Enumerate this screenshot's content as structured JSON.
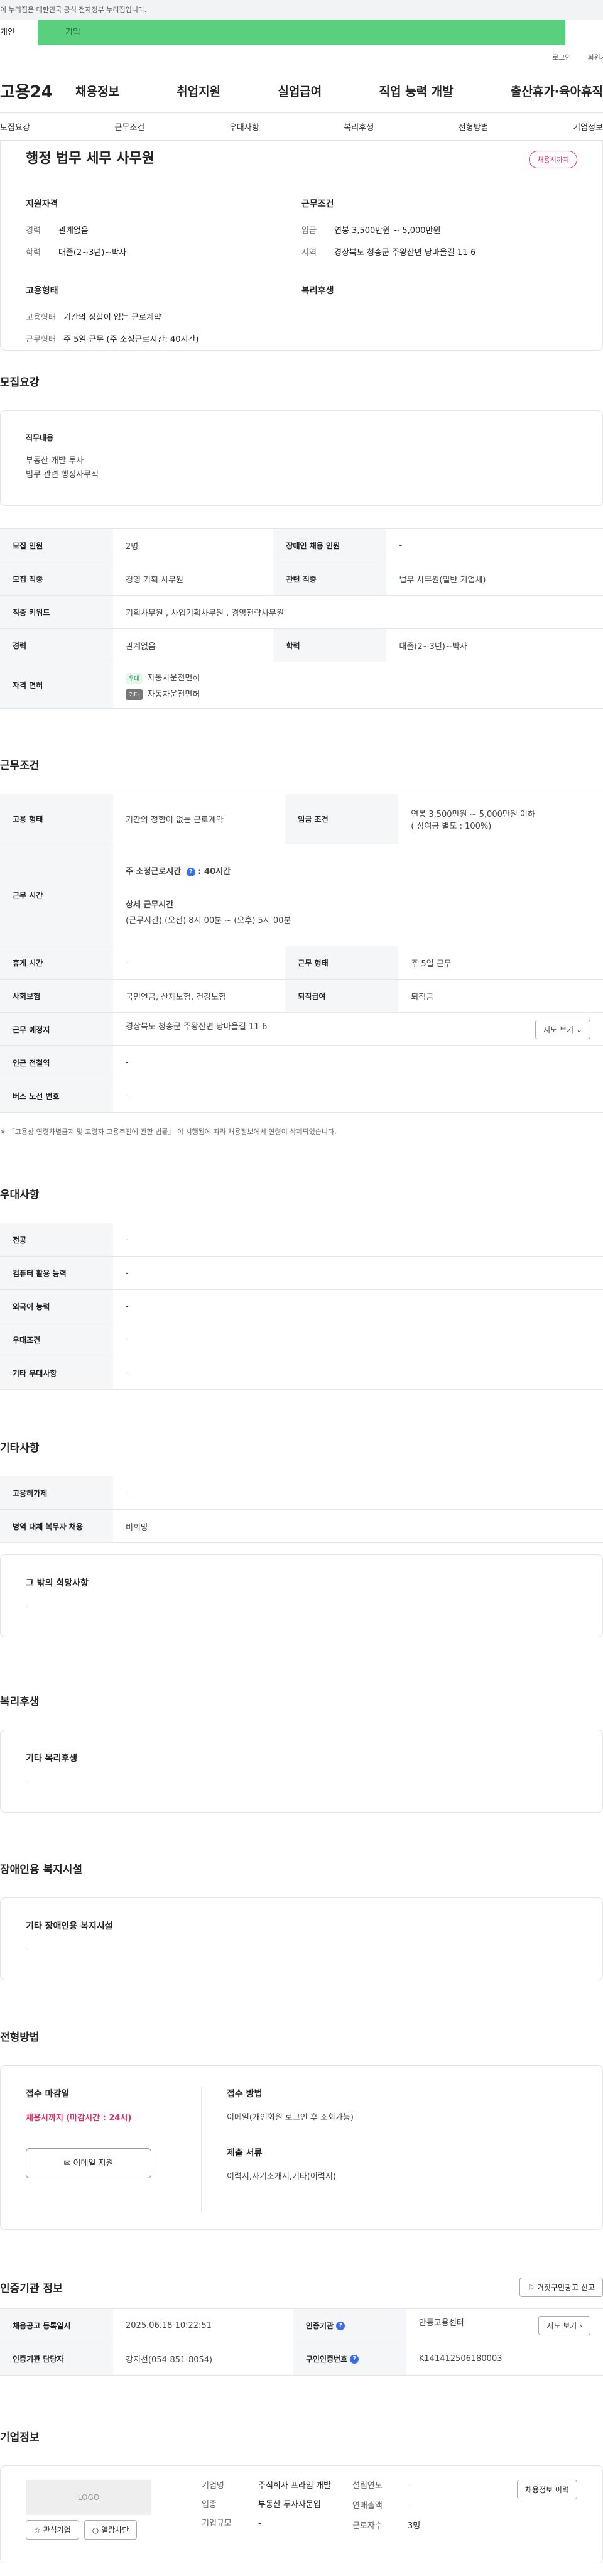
{
  "gov_banner": "이 누리집은 대한민국 공식 전자정부 누리집입니다.",
  "user_tabs": [
    "개인",
    "기업"
  ],
  "util": [
    "로그인",
    "회원가입"
  ],
  "logo": "고용24",
  "gnb": [
    "채용정보",
    "취업지원",
    "실업급여",
    "직업 능력 개발",
    "출산휴가·육아휴직"
  ],
  "subnav": [
    "모집요강",
    "근무조건",
    "우대사항",
    "복리후생",
    "전형방법",
    "기업정보"
  ],
  "top": {
    "title": "행정 법무 세무 사무원",
    "badge": "채용시까지",
    "qual_h": "지원자격",
    "qual": [
      [
        "경력",
        "관계없음"
      ],
      [
        "학력",
        "대졸(2~3년)~박사"
      ]
    ],
    "cond_h": "근무조건",
    "cond": [
      [
        "임금",
        "연봉 3,500만원 ~ 5,000만원"
      ],
      [
        "지역",
        "경상북도 청송군 주왕산면 당마을길 11-6"
      ]
    ],
    "emp_h": "고용형태",
    "emp": [
      [
        "고용형태",
        "기간의 정함이 없는 근로계약"
      ],
      [
        "근무형태",
        "주 5일 근무 (주 소정근로시간: 40시간)"
      ]
    ],
    "welfare_h": "복리후생"
  },
  "recruit": {
    "title": "모집요강",
    "duty_h": "직무내용",
    "duty": [
      "부동산 개발 투자",
      "법무 관련 행정사무직"
    ],
    "rows": [
      [
        "모집 인원",
        "2명",
        "장애인 채용 인원",
        "-"
      ],
      [
        "모집 직종",
        "경영 기획 사무원",
        "관련 직종",
        "법무 사무원(일반 기업체)"
      ],
      [
        "직종 키워드",
        "기획사무원 , 사업기획사무원 , 경영전략사무원"
      ],
      [
        "경력",
        "관계없음",
        "학력",
        "대졸(2~3년)~박사"
      ]
    ],
    "license_h": "자격 면허",
    "lic": [
      {
        "tag": "우대",
        "name": "자동차운전면허"
      },
      {
        "tag": "기타",
        "name": "자동차운전면허"
      }
    ]
  },
  "work": {
    "title": "근무조건",
    "emp_type_h": "고용 형태",
    "emp_type": "기간의 정함이 없는 근로계약",
    "wage_h": "임금 조건",
    "wage": "연봉 3,500만원 ~ 5,000만원 이하",
    "wage_sub": "( 상여금 별도 : 100%)",
    "hours_h": "근무 시간",
    "hours_main": "주 소정근로시간",
    "hours_val": "40시간",
    "detail_h": "상세 근무시간",
    "detail": "(근무시간) (오전) 8시 00분 ~ (오후) 5시 00분",
    "rows": [
      [
        "휴게 시간",
        "-",
        "근무 형태",
        "주 5일 근무"
      ],
      [
        "사회보험",
        "국민연금, 산재보험, 건강보험",
        "퇴직급여",
        "퇴직금"
      ]
    ],
    "loc_h": "근무 예정지",
    "loc": "경상북도 청송군 주왕산면 당마을길 11-6",
    "map_btn": "지도 보기",
    "subway_h": "인근 전철역",
    "subway": "-",
    "bus_h": "버스 노선 번호",
    "bus": "-",
    "note": "※ 「고용상 연령차별금지 및 고령자 고용촉진에 관한 법률」 이 시행됨에 따라 채용정보에서 연령이 삭제되었습니다."
  },
  "pref": {
    "title": "우대사항",
    "rows": [
      [
        "전공",
        "-"
      ],
      [
        "컴퓨터 활용 능력",
        "-"
      ],
      [
        "외국어 능력",
        "-"
      ],
      [
        "우대조건",
        "-"
      ],
      [
        "기타 우대사항",
        "-"
      ]
    ]
  },
  "etc": {
    "title": "기타사항",
    "rows": [
      [
        "고용허가제",
        "-"
      ],
      [
        "병역 대체 복무자 채용",
        "비희망"
      ]
    ],
    "wish_h": "그 밖의 희망사항",
    "wish": "-"
  },
  "welfare": {
    "title": "복리후생",
    "h": "기타 복리후생",
    "v": "-"
  },
  "disab": {
    "title": "장애인용 복지시설",
    "h": "기타 장애인용 복지시설",
    "v": "-"
  },
  "process": {
    "title": "전형방법",
    "deadline_h": "접수 마감일",
    "deadline": "채용시까지 (마감시간 : 24시)",
    "method_h": "접수 방법",
    "method": "이메일(개인회원 로그인 후 조회가능)",
    "docs_h": "제출 서류",
    "docs": "이력서,자기소개서,기타(이력서)",
    "email_btn": "이메일 지원"
  },
  "cert": {
    "title": "인증기관 정보",
    "report_btn": "거짓구인광고 신고",
    "rows": [
      [
        "채용공고 등록일시",
        "2025.06.18 10:22:51",
        "인증기관",
        "안동고용센터"
      ],
      [
        "인증기관 담당자",
        "강지선(054-851-8054)",
        "구인인증번호",
        "K141412506180003"
      ]
    ],
    "map_btn": "지도 보기"
  },
  "company": {
    "title": "기업정보",
    "logo": "LOGO",
    "fav": "관심기업",
    "block": "열람차단",
    "history_btn": "채용정보 이력",
    "f1": [
      [
        "기업명",
        "주식회사 프라임 개발"
      ],
      [
        "업종",
        "부동산 투자자문업"
      ],
      [
        "기업규모",
        "-"
      ]
    ],
    "f2": [
      [
        "설립연도",
        "-"
      ],
      [
        "연매출액",
        "-"
      ],
      [
        "근로자수",
        "3명"
      ]
    ]
  }
}
